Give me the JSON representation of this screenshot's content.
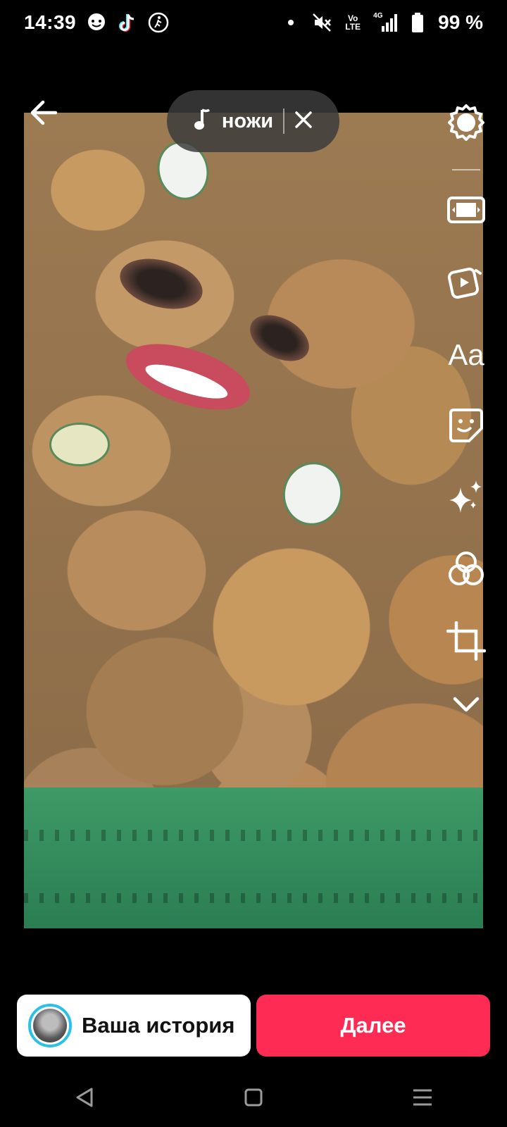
{
  "status_bar": {
    "time": "14:39",
    "network": "4G",
    "volte_top": "Vo",
    "volte_bottom": "LTE",
    "battery_percent": "99 %",
    "battery_level": 0.99,
    "left_icons": [
      "chat-bubble-icon",
      "tiktok-icon",
      "accessibility-icon"
    ],
    "right_icons": [
      "dot-icon",
      "mute-icon",
      "volte-icon",
      "signal-icon",
      "battery-icon"
    ]
  },
  "editor": {
    "back_icon": "arrow-left-icon",
    "music": {
      "icon": "music-note-icon",
      "title": "ножи",
      "close_icon": "close-icon"
    },
    "tools": [
      {
        "name": "settings",
        "icon": "gear-icon"
      },
      {
        "name": "aspect",
        "icon": "aspect-ratio-icon"
      },
      {
        "name": "templates",
        "icon": "video-template-icon"
      },
      {
        "name": "text",
        "label": "Aa"
      },
      {
        "name": "stickers",
        "icon": "sticker-icon"
      },
      {
        "name": "effects",
        "icon": "sparkle-icon"
      },
      {
        "name": "filters",
        "icon": "filters-icon"
      },
      {
        "name": "crop",
        "icon": "crop-icon"
      },
      {
        "name": "more",
        "icon": "chevron-down-icon"
      }
    ]
  },
  "bottom": {
    "story_label": "Ваша история",
    "next_label": "Далее",
    "next_color": "#fe2c55",
    "avatar_ring_color": "#29c1e6"
  },
  "nav": {
    "icons": [
      "back-triangle-icon",
      "home-square-icon",
      "menu-lines-icon"
    ]
  }
}
